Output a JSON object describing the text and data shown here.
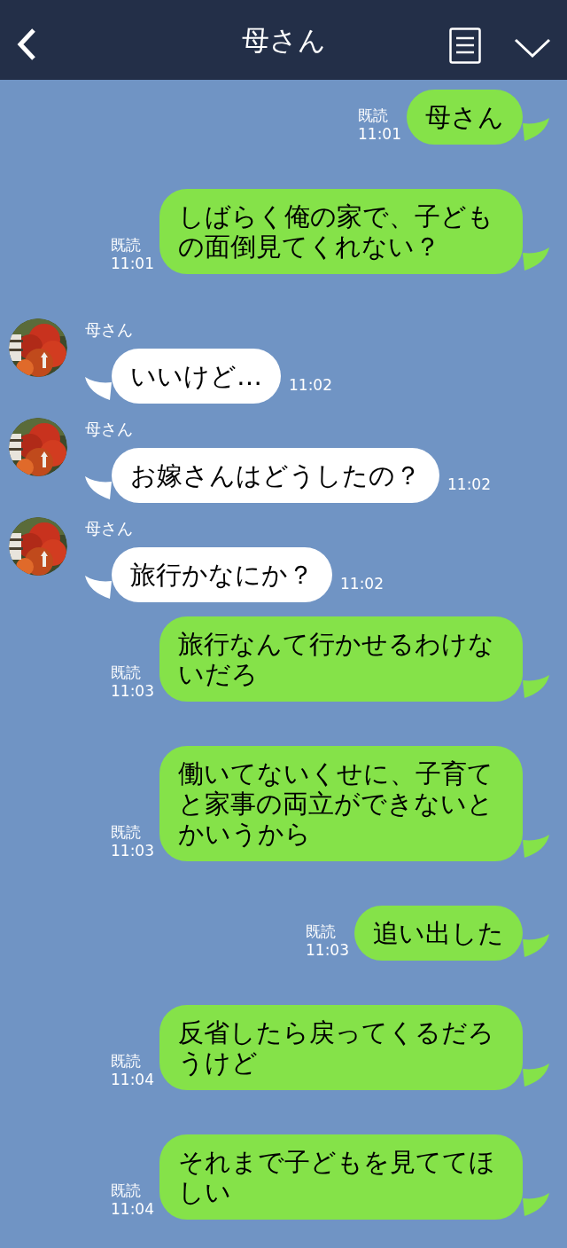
{
  "header": {
    "title": "母さん"
  },
  "messages": [
    {
      "kind": "sent",
      "text": "母さん",
      "read": "既読",
      "time": "11:01"
    },
    {
      "kind": "sent",
      "text": "しばらく俺の家で、子どもの面倒見てくれない？",
      "read": "既読",
      "time": "11:01"
    },
    {
      "kind": "received",
      "sender": "母さん",
      "text": "いいけど…",
      "time": "11:02"
    },
    {
      "kind": "received",
      "sender": "母さん",
      "text": "お嫁さんはどうしたの？",
      "time": "11:02"
    },
    {
      "kind": "received",
      "sender": "母さん",
      "text": "旅行かなにか？",
      "time": "11:02"
    },
    {
      "kind": "sent",
      "text": "旅行なんて行かせるわけないだろ",
      "read": "既読",
      "time": "11:03"
    },
    {
      "kind": "sent",
      "text": "働いてないくせに、子育てと家事の両立ができないとかいうから",
      "read": "既読",
      "time": "11:03"
    },
    {
      "kind": "sent",
      "text": "追い出した",
      "read": "既読",
      "time": "11:03"
    },
    {
      "kind": "sent",
      "text": "反省したら戻ってくるだろうけど",
      "read": "既読",
      "time": "11:04"
    },
    {
      "kind": "sent",
      "text": "それまで子どもを見ててほしい",
      "read": "既読",
      "time": "11:04"
    }
  ]
}
